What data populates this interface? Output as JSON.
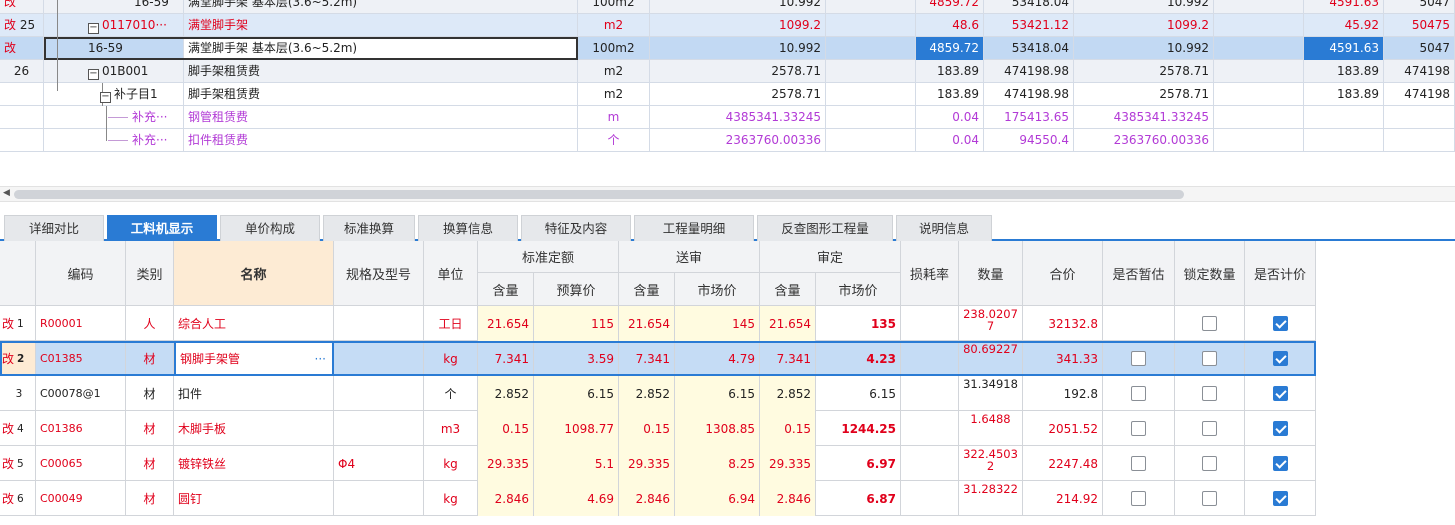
{
  "upper": {
    "rows": [
      {
        "mark": "改",
        "seq": "",
        "code": "16-59",
        "name": "满堂脚手架 基本层(3.6~5.2m)",
        "unit": "100m2",
        "qty": "10.992",
        "price": "4859.72",
        "total": "53418.04",
        "qty2": "10.992",
        "price2": "4591.63",
        "total2": "5047"
      },
      {
        "mark": "改",
        "seq": "25",
        "code": "0117010···",
        "name": "满堂脚手架",
        "unit": "m2",
        "qty": "1099.2",
        "price": "48.6",
        "total": "53421.12",
        "qty2": "1099.2",
        "price2": "45.92",
        "total2": "50475"
      },
      {
        "mark": "改",
        "seq": "",
        "code": "16-59",
        "name": "满堂脚手架 基本层(3.6~5.2m)",
        "unit": "100m2",
        "qty": "10.992",
        "price": "4859.72",
        "total": "53418.04",
        "qty2": "10.992",
        "price2": "4591.63",
        "total2": "5047"
      },
      {
        "mark": "",
        "seq": "26",
        "code": "01B001",
        "name": "脚手架租赁费",
        "unit": "m2",
        "qty": "2578.71",
        "price": "183.89",
        "total": "474198.98",
        "qty2": "2578.71",
        "price2": "183.89",
        "total2": "474198"
      },
      {
        "mark": "",
        "seq": "",
        "code": "补子目1",
        "name": "脚手架租赁费",
        "unit": "m2",
        "qty": "2578.71",
        "price": "183.89",
        "total": "474198.98",
        "qty2": "2578.71",
        "price2": "183.89",
        "total2": "474198"
      },
      {
        "mark": "",
        "seq": "",
        "code": "补充···",
        "name": "钢管租赁费",
        "unit": "m",
        "qty": "4385341.33245",
        "price": "0.04",
        "total": "175413.65",
        "qty2": "4385341.33245",
        "price2": "",
        "total2": ""
      },
      {
        "mark": "",
        "seq": "",
        "code": "补充···",
        "name": "扣件租赁费",
        "unit": "个",
        "qty": "2363760.00336",
        "price": "0.04",
        "total": "94550.4",
        "qty2": "2363760.00336",
        "price2": "",
        "total2": ""
      }
    ]
  },
  "tabs": [
    {
      "label": "详细对比"
    },
    {
      "label": "工料机显示"
    },
    {
      "label": "单价构成"
    },
    {
      "label": "标准换算"
    },
    {
      "label": "换算信息"
    },
    {
      "label": "特征及内容"
    },
    {
      "label": "工程量明细"
    },
    {
      "label": "反查图形工程量"
    },
    {
      "label": "说明信息"
    }
  ],
  "header": {
    "code": "编码",
    "type": "类别",
    "name": "名称",
    "spec": "规格及型号",
    "unit": "单位",
    "std_group": "标准定额",
    "sub_group": "送审",
    "aud_group": "审定",
    "content": "含量",
    "budget_price": "预算价",
    "market_price": "市场价",
    "loss": "损耗率",
    "quantity": "数量",
    "total": "合价",
    "temp": "是否暂估",
    "lock": "锁定数量",
    "priced": "是否计价"
  },
  "rows": [
    {
      "mark": "改",
      "seq": "1",
      "code": "R00001",
      "type": "人",
      "name": "综合人工",
      "spec": "",
      "unit": "工日",
      "std_content": "21.654",
      "std_price": "115",
      "sub_content": "21.654",
      "sub_price": "145",
      "aud_content": "21.654",
      "aud_price": "135",
      "loss": "",
      "qty": "238.02077",
      "total": "32132.8",
      "temp": null,
      "lock": false,
      "priced": true
    },
    {
      "mark": "改",
      "seq": "2",
      "code": "C01385",
      "type": "材",
      "name": "钢脚手架管",
      "spec": "",
      "unit": "kg",
      "std_content": "7.341",
      "std_price": "3.59",
      "sub_content": "7.341",
      "sub_price": "4.79",
      "aud_content": "7.341",
      "aud_price": "4.23",
      "loss": "",
      "qty": "80.69227",
      "total": "341.33",
      "temp": false,
      "lock": false,
      "priced": true
    },
    {
      "mark": "",
      "seq": "3",
      "code": "C00078@1",
      "type": "材",
      "name": "扣件",
      "spec": "",
      "unit": "个",
      "std_content": "2.852",
      "std_price": "6.15",
      "sub_content": "2.852",
      "sub_price": "6.15",
      "aud_content": "2.852",
      "aud_price": "6.15",
      "loss": "",
      "qty": "31.34918",
      "total": "192.8",
      "temp": false,
      "lock": false,
      "priced": true
    },
    {
      "mark": "改",
      "seq": "4",
      "code": "C01386",
      "type": "材",
      "name": "木脚手板",
      "spec": "",
      "unit": "m3",
      "std_content": "0.15",
      "std_price": "1098.77",
      "sub_content": "0.15",
      "sub_price": "1308.85",
      "aud_content": "0.15",
      "aud_price": "1244.25",
      "loss": "",
      "qty": "1.6488",
      "total": "2051.52",
      "temp": false,
      "lock": false,
      "priced": true
    },
    {
      "mark": "改",
      "seq": "5",
      "code": "C00065",
      "type": "材",
      "name": "镀锌铁丝",
      "spec": "Φ4",
      "unit": "kg",
      "std_content": "29.335",
      "std_price": "5.1",
      "sub_content": "29.335",
      "sub_price": "8.25",
      "aud_content": "29.335",
      "aud_price": "6.97",
      "loss": "",
      "qty": "322.45032",
      "total": "2247.48",
      "temp": false,
      "lock": false,
      "priced": true
    },
    {
      "mark": "改",
      "seq": "6",
      "code": "C00049",
      "type": "材",
      "name": "圆钉",
      "spec": "",
      "unit": "kg",
      "std_content": "2.846",
      "std_price": "4.69",
      "sub_content": "2.846",
      "sub_price": "6.94",
      "aud_content": "2.846",
      "aud_price": "6.87",
      "loss": "",
      "qty": "31.28322",
      "total": "214.92",
      "temp": false,
      "lock": false,
      "priced": true
    }
  ],
  "colors": {
    "accent": "#2a7bd4",
    "changed": "#e0001b",
    "supplement": "#b23ad6"
  }
}
